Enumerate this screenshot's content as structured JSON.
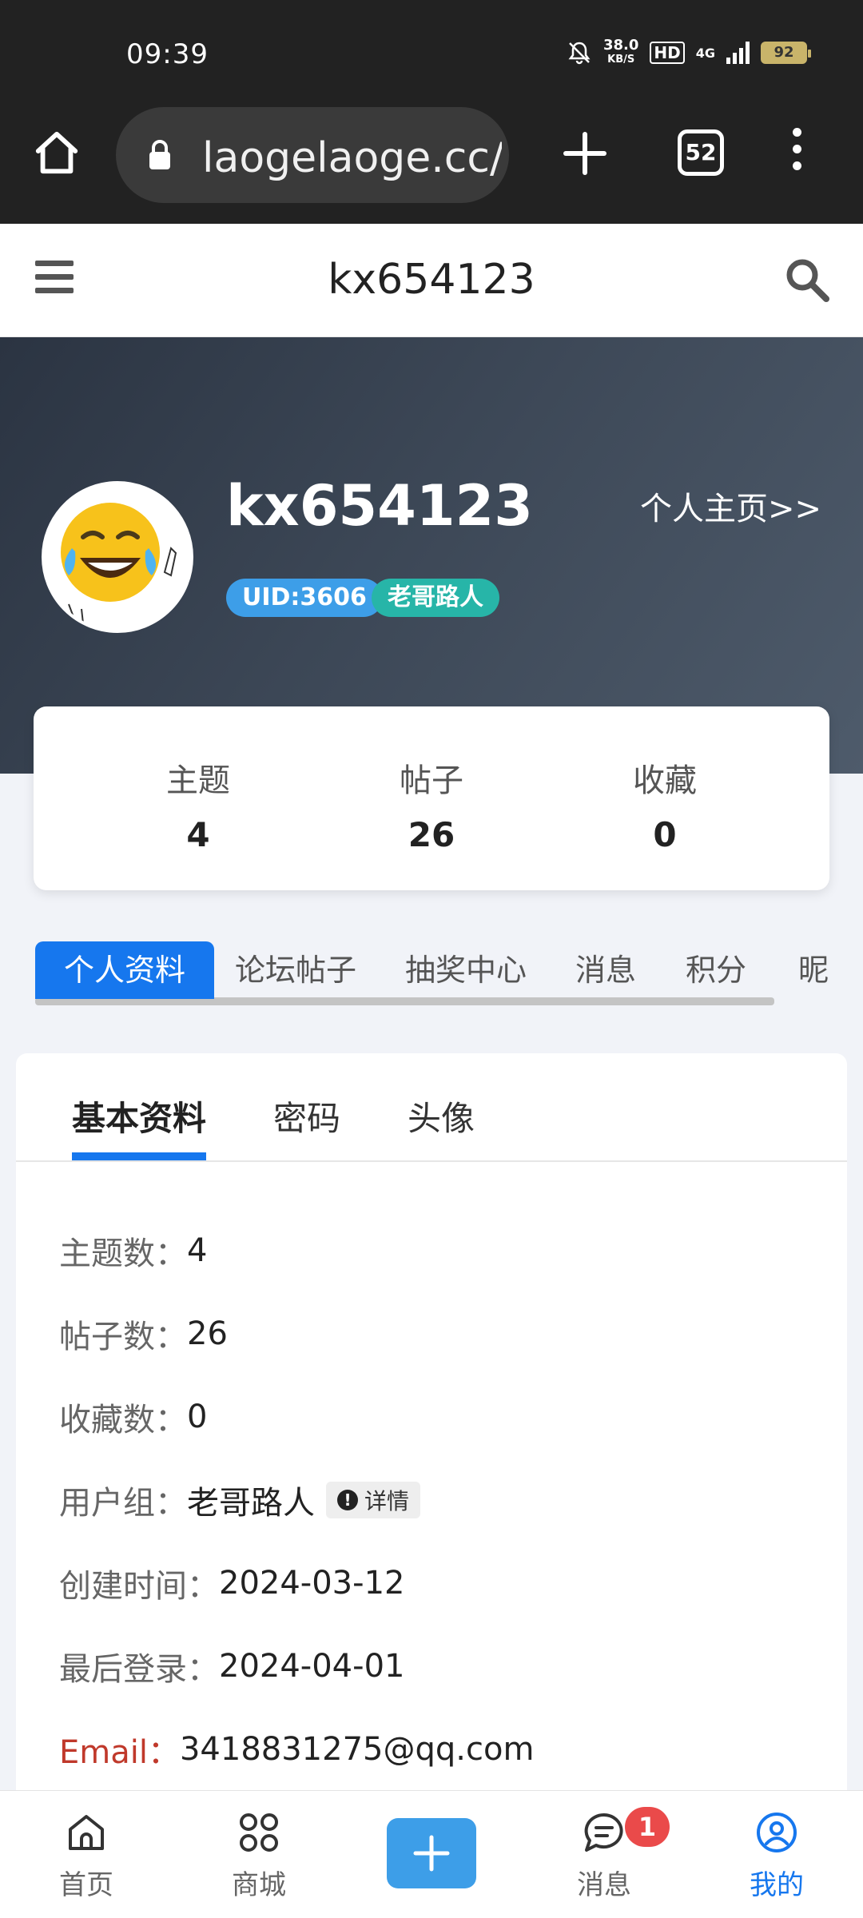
{
  "status_bar": {
    "time": "09:39",
    "speed_value": "38.0",
    "speed_unit": "KB/S",
    "hd": "HD",
    "network": "4G",
    "battery": "92"
  },
  "browser": {
    "url": "laogelaoge.cc/",
    "tab_count": "52"
  },
  "site_header": {
    "title": "kx654123"
  },
  "profile": {
    "username": "kx654123",
    "home_link": "个人主页>>",
    "uid_badge": "UID:3606",
    "group_badge": "老哥路人"
  },
  "stats": [
    {
      "label": "主题",
      "value": "4"
    },
    {
      "label": "帖子",
      "value": "26"
    },
    {
      "label": "收藏",
      "value": "0"
    }
  ],
  "tabs": [
    "个人资料",
    "论坛帖子",
    "抽奖中心",
    "消息",
    "积分",
    "昵"
  ],
  "sub_tabs": [
    "基本资料",
    "密码",
    "头像"
  ],
  "info": {
    "topics_label": "主题数：",
    "topics_value": "4",
    "posts_label": "帖子数：",
    "posts_value": "26",
    "favorites_label": "收藏数：",
    "favorites_value": "0",
    "group_label": "用户组：",
    "group_value": "老哥路人",
    "detail_label": "详情",
    "created_label": "创建时间：",
    "created_value": "2024-03-12",
    "last_login_label": "最后登录：",
    "last_login_value": "2024-04-01",
    "email_label": "Email：",
    "email_value": "3418831275@qq.com"
  },
  "bottom_nav": {
    "home": "首页",
    "shop": "商城",
    "messages": "消息",
    "messages_badge": "1",
    "mine": "我的"
  },
  "colors": {
    "accent": "#1677ee",
    "uid_badge": "#3d9ee8",
    "group_badge": "#27b5a8",
    "email_label": "#c0392b",
    "notification": "#ea4a4a"
  }
}
